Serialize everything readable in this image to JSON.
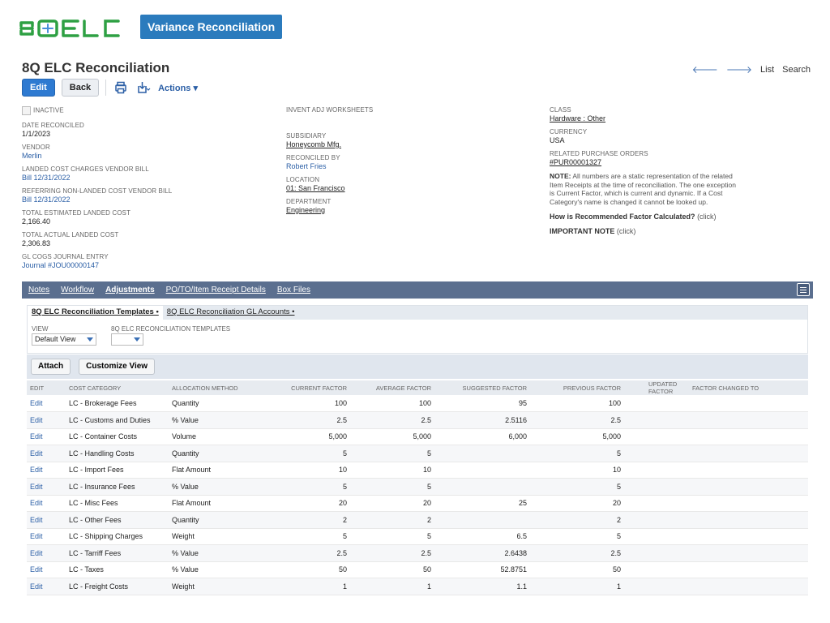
{
  "brand": {
    "logo_text": "8QELC",
    "banner": "Variance Reconciliation",
    "logo_color": "#2ea043"
  },
  "header": {
    "title": "8Q ELC Reconciliation"
  },
  "top_nav": {
    "back_icon": "arrow-left-icon",
    "forward_icon": "arrow-right-icon",
    "list": "List",
    "search": "Search"
  },
  "toolbar": {
    "edit": "Edit",
    "back": "Back",
    "actions": "Actions ▾",
    "print_icon": "print-icon",
    "download_icon": "download-icon"
  },
  "fields_left": {
    "inactive": "INACTIVE",
    "date_reconciled_label": "DATE RECONCILED",
    "date_reconciled": "1/1/2023",
    "vendor_label": "VENDOR",
    "vendor": "Merlin",
    "lc_vendor_bill_label": "LANDED COST CHARGES VENDOR BILL",
    "lc_vendor_bill": "Bill 12/31/2022",
    "nonlc_vendor_bill_label": "REFERRING NON-LANDED COST VENDOR BILL",
    "nonlc_vendor_bill": "Bill 12/31/2022",
    "total_est_label": "TOTAL ESTIMATED LANDED COST",
    "total_est": "2,166.40",
    "total_actual_label": "TOTAL ACTUAL LANDED COST",
    "total_actual": "2,306.83",
    "gl_cogs_label": "GL COGS JOURNAL ENTRY",
    "gl_cogs": "Journal #JOU00000147"
  },
  "fields_mid": {
    "invent_adj_label": "INVENT ADJ WORKSHEETS",
    "subsidiary_label": "SUBSIDIARY",
    "subsidiary": "Honeycomb Mfg.",
    "reconciled_by_label": "RECONCILED BY",
    "reconciled_by": "Robert Fries",
    "location_label": "LOCATION",
    "location": "01: San Francisco",
    "department_label": "DEPARTMENT",
    "department": "Engineering"
  },
  "fields_right": {
    "class_label": "CLASS",
    "class": "Hardware : Other",
    "currency_label": "CURRENCY",
    "currency": "USA",
    "related_po_label": "RELATED PURCHASE ORDERS",
    "related_po": "#PUR00001327",
    "note_title": "NOTE:",
    "note_text": "All numbers are a static representation of the related Item Receipts at the time of reconciliation. The one exception is Current Factor, which is current and dynamic. If a Cost Category's name is changed it cannot be looked up.",
    "how_calc": "How is Recommended Factor Calculated?",
    "important": "IMPORTANT NOTE",
    "click": "(click)"
  },
  "tabs": [
    "Notes",
    "Workflow",
    "Adjustments",
    "PO/TO/Item Receipt Details",
    "Box Files"
  ],
  "active_tab": "Adjustments",
  "subtabs": [
    "8Q ELC Reconciliation Templates •",
    "8Q ELC Reconciliation GL Accounts •"
  ],
  "view": {
    "view_label": "VIEW",
    "view_value": "Default View",
    "templates_label": "8Q ELC RECONCILIATION TEMPLATES",
    "templates_value": ""
  },
  "grid_toolbar": {
    "attach": "Attach",
    "customize": "Customize View"
  },
  "table": {
    "headers": [
      "EDIT",
      "COST CATEGORY",
      "ALLOCATION METHOD",
      "CURRENT FACTOR",
      "AVERAGE FACTOR",
      "SUGGESTED FACTOR",
      "PREVIOUS FACTOR",
      "UPDATED FACTOR",
      "FACTOR CHANGED TO"
    ],
    "rows": [
      [
        "Edit",
        "LC - Brokerage Fees",
        "Quantity",
        "100",
        "100",
        "95",
        "100",
        "",
        ""
      ],
      [
        "Edit",
        "LC - Customs and Duties",
        "% Value",
        "2.5",
        "2.5",
        "2.5116",
        "2.5",
        "",
        ""
      ],
      [
        "Edit",
        "LC - Container Costs",
        "Volume",
        "5,000",
        "5,000",
        "6,000",
        "5,000",
        "",
        ""
      ],
      [
        "Edit",
        "LC - Handling Costs",
        "Quantity",
        "5",
        "5",
        "",
        "5",
        "",
        ""
      ],
      [
        "Edit",
        "LC - Import Fees",
        "Flat Amount",
        "10",
        "10",
        "",
        "10",
        "",
        ""
      ],
      [
        "Edit",
        "LC - Insurance Fees",
        "% Value",
        "5",
        "5",
        "",
        "5",
        "",
        ""
      ],
      [
        "Edit",
        "LC - Misc Fees",
        "Flat Amount",
        "20",
        "20",
        "25",
        "20",
        "",
        ""
      ],
      [
        "Edit",
        "LC - Other Fees",
        "Quantity",
        "2",
        "2",
        "",
        "2",
        "",
        ""
      ],
      [
        "Edit",
        "LC - Shipping Charges",
        "Weight",
        "5",
        "5",
        "6.5",
        "5",
        "",
        ""
      ],
      [
        "Edit",
        "LC - Tarriff Fees",
        "% Value",
        "2.5",
        "2.5",
        "2.6438",
        "2.5",
        "",
        ""
      ],
      [
        "Edit",
        "LC - Taxes",
        "% Value",
        "50",
        "50",
        "52.8751",
        "50",
        "",
        ""
      ],
      [
        "Edit",
        "LC - Freight Costs",
        "Weight",
        "1",
        "1",
        "1.1",
        "1",
        "",
        ""
      ]
    ]
  },
  "colors": {
    "accent": "#2b7bbd",
    "tabbar": "#5b6f8f",
    "link": "#2b5fa6"
  }
}
